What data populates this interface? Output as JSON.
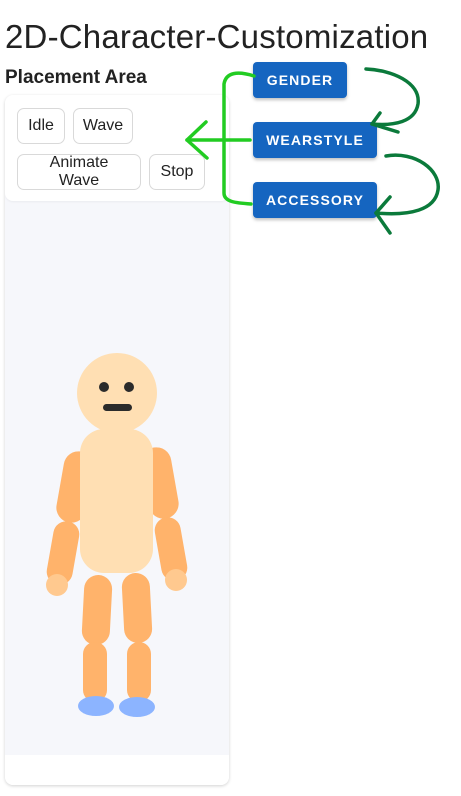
{
  "page": {
    "title": "2D-Character-Customization",
    "section_title": "Placement Area"
  },
  "toolbar": {
    "idle_label": "Idle",
    "wave_label": "Wave",
    "animate_wave_label": "Animate Wave",
    "stop_label": "Stop"
  },
  "customize": {
    "gender_label": "GENDER",
    "wearstyle_label": "WEARSTYLE",
    "accessory_label": "ACCESSORY"
  },
  "colors": {
    "primary_button": "#1565c0",
    "skin_light": "#ffdfb3",
    "limb": "#ffb36b",
    "shoe": "#8cb4ff",
    "annotation_light_green": "#22cc22",
    "annotation_dark_green": "#0b7a3b"
  }
}
